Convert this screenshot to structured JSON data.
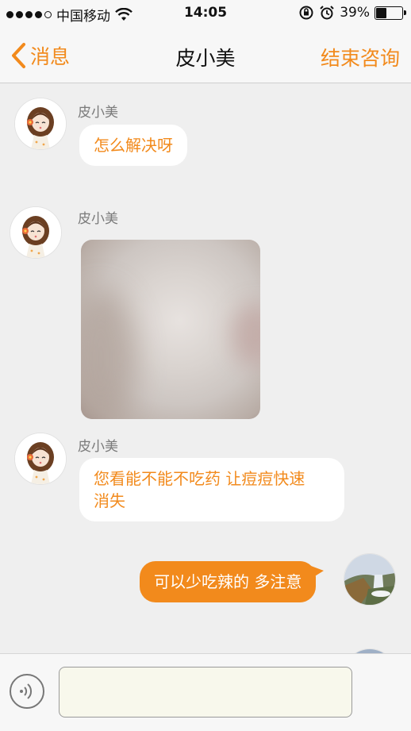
{
  "status_bar": {
    "carrier": "中国移动",
    "time": "14:05",
    "battery_text": "39%",
    "battery_level": 0.39,
    "signal_dots": 5,
    "signal_filled": 4
  },
  "nav": {
    "back_label": "消息",
    "title": "皮小美",
    "end_label": "结束咨询"
  },
  "messages": [
    {
      "sender": "皮小美",
      "type": "text",
      "text": "怎么解决呀"
    },
    {
      "sender": "皮小美",
      "type": "image"
    },
    {
      "sender": "皮小美",
      "type": "text",
      "text_line1": "您看能不能不吃药 让痘痘快速",
      "text_line2": "消失"
    },
    {
      "type": "text",
      "direction": "outgoing",
      "text": "可以少吃辣的 多注意"
    }
  ],
  "input": {
    "value": "",
    "voice_icon": "voice-wave-icon"
  },
  "colors": {
    "accent": "#f28a1c",
    "background": "#efefef"
  }
}
